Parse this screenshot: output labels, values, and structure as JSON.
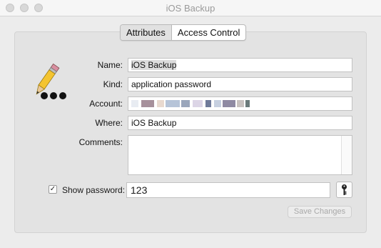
{
  "window": {
    "title": "iOS Backup"
  },
  "tabs": [
    {
      "label": "Attributes",
      "selected": true
    },
    {
      "label": "Access Control",
      "selected": false
    }
  ],
  "fields": {
    "name_label": "Name:",
    "name_value": "iOS Backup",
    "kind_label": "Kind:",
    "kind_value": "application password",
    "account_label": "Account:",
    "account_value": "",
    "where_label": "Where:",
    "where_value": "iOS Backup",
    "comments_label": "Comments:",
    "comments_value": ""
  },
  "password": {
    "show_label": "Show password:",
    "checked": true,
    "value": "123"
  },
  "buttons": {
    "save_label": "Save Changes"
  },
  "icons": {
    "item": "pencil-icon",
    "key": "key-icon"
  }
}
